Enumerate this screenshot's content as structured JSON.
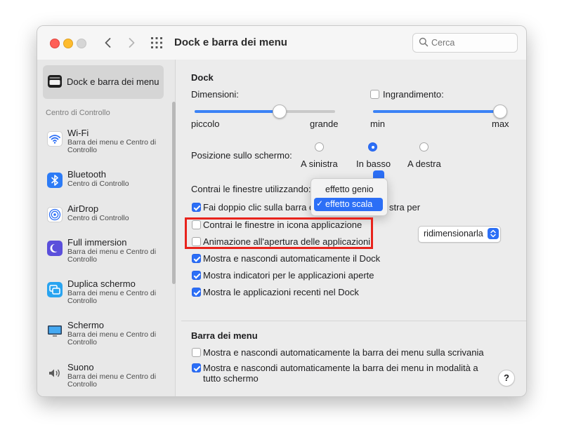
{
  "window": {
    "title": "Dock e barra dei menu",
    "search": {
      "placeholder": "Cerca"
    }
  },
  "sidebar": {
    "selected": "Dock e barra dei menu",
    "section": "Centro di Controllo",
    "items": [
      {
        "name": "Wi-Fi",
        "sub": "Barra dei menu e Centro di Controllo",
        "icon": "wifi-icon"
      },
      {
        "name": "Bluetooth",
        "sub": "Centro di Controllo",
        "icon": "bluetooth-icon"
      },
      {
        "name": "AirDrop",
        "sub": "Centro di Controllo",
        "icon": "airdrop-icon"
      },
      {
        "name": "Full immersion",
        "sub": "Barra dei menu e Centro di Controllo",
        "icon": "moon-icon"
      },
      {
        "name": "Duplica schermo",
        "sub": "Barra dei menu e Centro di Controllo",
        "icon": "mirror-screen-icon"
      },
      {
        "name": "Schermo",
        "sub": "Barra dei menu e Centro di Controllo",
        "icon": "display-icon"
      },
      {
        "name": "Suono",
        "sub": "Barra dei menu e Centro di Controllo",
        "icon": "speaker-icon"
      }
    ]
  },
  "dock": {
    "heading": "Dock",
    "size": {
      "label": "Dimensioni:",
      "min": "piccolo",
      "max": "grande",
      "value": 0.6
    },
    "magnification": {
      "label": "Ingrandimento:",
      "checked": false,
      "min": "min",
      "max": "max",
      "value": 1.0
    },
    "position": {
      "label": "Posizione sullo schermo:",
      "options": [
        "A sinistra",
        "In basso",
        "A destra"
      ],
      "selected": "In basso"
    },
    "minimize_effect": {
      "label": "Contrai le finestre utilizzando:",
      "menu": [
        "effetto genio",
        "effetto scala"
      ],
      "selected": "effetto scala"
    },
    "double_click": {
      "label_left": "Fai doppio clic sulla barra d",
      "label_right": "stra per",
      "checked": true,
      "popup_value": "ridimensionarla"
    },
    "checkboxes": [
      {
        "label": "Contrai le finestre in icona applicazione",
        "checked": false
      },
      {
        "label": "Animazione all'apertura delle applicazioni",
        "checked": false
      },
      {
        "label": "Mostra e nascondi automaticamente il Dock",
        "checked": true
      },
      {
        "label": "Mostra indicatori per le applicazioni aperte",
        "checked": true
      },
      {
        "label": "Mostra le applicazioni recenti nel Dock",
        "checked": true
      }
    ]
  },
  "menubar": {
    "heading": "Barra dei menu",
    "checkboxes": [
      {
        "label": "Mostra e nascondi automaticamente la barra dei menu sulla scrivania",
        "checked": false
      },
      {
        "label_line1": "Mostra e nascondi automaticamente la barra dei menu in modalità a",
        "label_line2": "tutto schermo",
        "checked": true
      }
    ]
  },
  "help": "?",
  "colors": {
    "accent": "#2c6ff6",
    "highlight": "#e8231c"
  }
}
